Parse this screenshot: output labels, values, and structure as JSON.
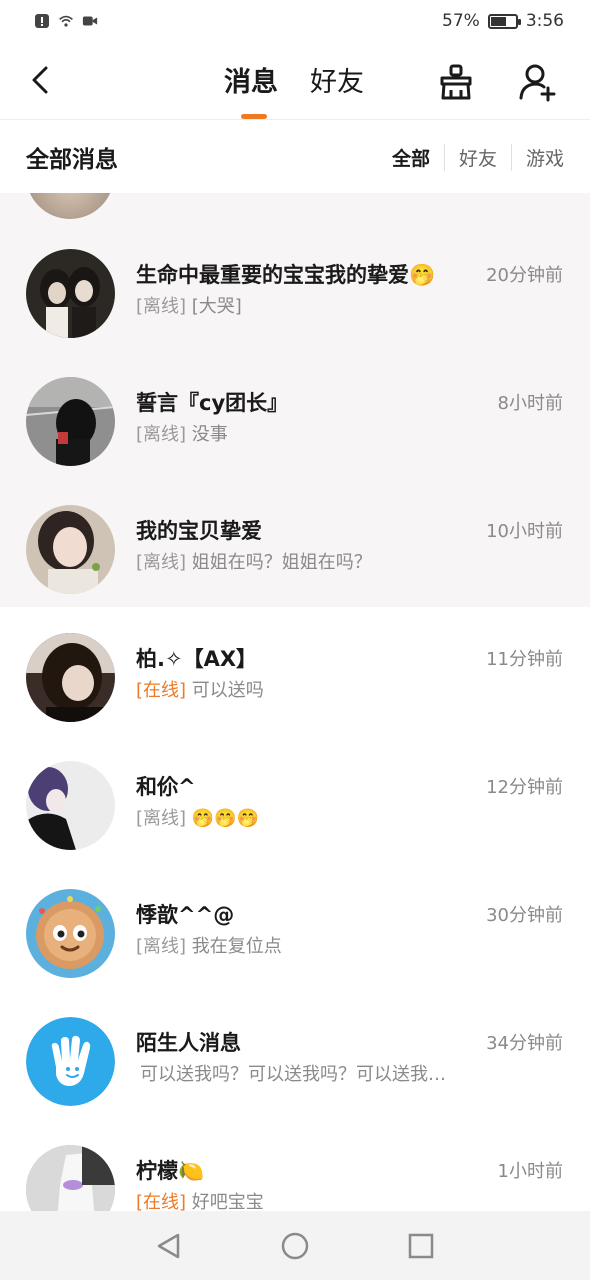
{
  "status_bar": {
    "battery_text": "57%",
    "battery_level": 0.57,
    "time": "3:56",
    "icons": [
      "alert-icon",
      "wifi-icon",
      "video-icon",
      "battery-icon"
    ]
  },
  "nav": {
    "tabs": [
      {
        "label": "消息",
        "active": true
      },
      {
        "label": "好友",
        "active": false
      }
    ],
    "accent_color": "#f07a23",
    "icons": [
      "back-icon",
      "clean-icon",
      "add-friend-icon"
    ]
  },
  "section": {
    "title": "全部消息",
    "filters": [
      {
        "label": "全部",
        "active": true
      },
      {
        "label": "好友",
        "active": false
      },
      {
        "label": "游戏",
        "active": false
      }
    ]
  },
  "conversations": [
    {
      "name": "生命中最重要的宝宝我的挚爱",
      "name_emoji": "🤭",
      "time": "20分钟前",
      "status": "[离线]",
      "status_type": "offline",
      "preview": "[大哭]",
      "pinned": true
    },
    {
      "name": "誓言『cy团长』",
      "time": "8小时前",
      "status": "[离线]",
      "status_type": "offline",
      "preview": "没事",
      "pinned": true
    },
    {
      "name": "我的宝贝挚爱",
      "time": "10小时前",
      "status": "[离线]",
      "status_type": "offline",
      "preview": "姐姐在吗？姐姐在吗？",
      "pinned": true
    },
    {
      "name": "柏.✧【AX】",
      "time": "11分钟前",
      "status": "[在线]",
      "status_type": "online",
      "preview": "可以送吗",
      "pinned": false
    },
    {
      "name": "和伱^",
      "time": "12分钟前",
      "status": "[离线]",
      "status_type": "offline",
      "preview": "🤭🤭🤭",
      "pinned": false
    },
    {
      "name": "悸歆^^@",
      "time": "30分钟前",
      "status": "[离线]",
      "status_type": "offline",
      "preview": "我在复位点",
      "pinned": false
    },
    {
      "name": "陌生人消息",
      "time": "34分钟前",
      "status": "",
      "status_type": "none",
      "preview": "可以送我吗？可以送我吗？可以送我…",
      "pinned": false
    },
    {
      "name": "柠檬",
      "name_emoji": "🍋",
      "time": "1小时前",
      "status": "[在线]",
      "status_type": "online",
      "preview": "好吧宝宝",
      "pinned": false
    }
  ],
  "system_nav": {
    "icons": [
      "back-triangle-icon",
      "home-circle-icon",
      "recents-square-icon"
    ]
  }
}
